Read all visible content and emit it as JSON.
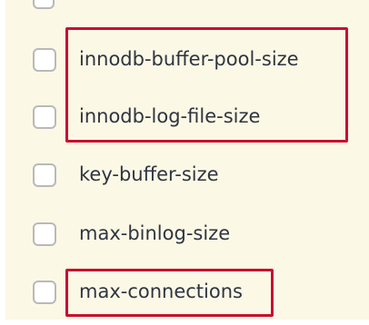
{
  "options": [
    {
      "label": "innodb-buffer-pool-size",
      "checked": false
    },
    {
      "label": "innodb-log-file-size",
      "checked": false
    },
    {
      "label": "key-buffer-size",
      "checked": false
    },
    {
      "label": "max-binlog-size",
      "checked": false
    },
    {
      "label": "max-connections",
      "checked": false
    }
  ],
  "highlight_color": "#c8102e",
  "panel_color": "#fcf8e6"
}
